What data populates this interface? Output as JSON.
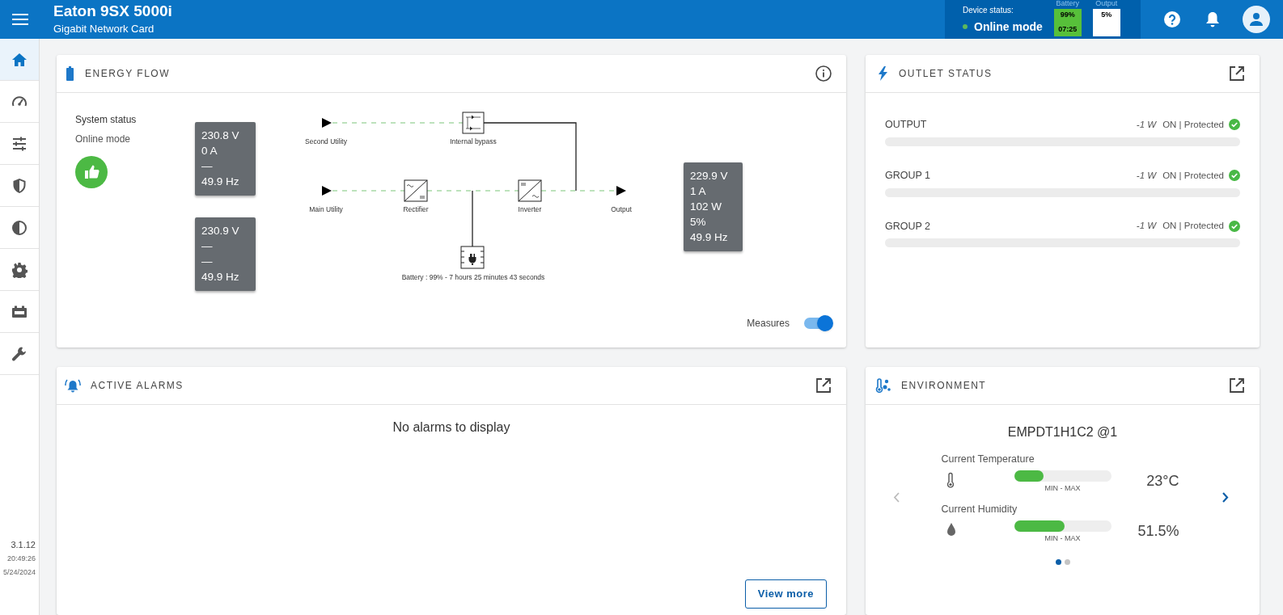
{
  "header": {
    "title": "Eaton 9SX 5000i",
    "subtitle": "Gigabit Network Card",
    "device_status_label": "Device status:",
    "device_status": "Online mode",
    "battery_label": "Battery",
    "battery_percent": "99%",
    "battery_time": "07:25",
    "output_label": "Output",
    "output_percent": "5%"
  },
  "sidebar": {
    "items": [
      {
        "selected": true
      },
      {
        "selected": false
      },
      {
        "selected": false
      },
      {
        "selected": false
      },
      {
        "selected": false
      },
      {
        "selected": false
      },
      {
        "selected": false
      },
      {
        "selected": false
      }
    ],
    "version": "3.1.12",
    "time": "20:49:26",
    "date": "5/24/2024"
  },
  "energy_flow": {
    "title": "ENERGY FLOW",
    "system_status_label": "System status",
    "system_status": "Online mode",
    "input_measures": [
      [
        "230.8 V",
        "0 A",
        "—",
        "49.9 Hz"
      ],
      [
        "230.9 V",
        "—",
        "—",
        "49.9 Hz"
      ]
    ],
    "nodes": [
      {
        "label": "Second Utility"
      },
      {
        "label": "Internal bypass"
      },
      {
        "label": "Main Utility"
      },
      {
        "label": "Rectifier"
      },
      {
        "label": "Inverter"
      },
      {
        "label": "Output"
      },
      {
        "label": "Battery : 99% - 7 hours 25 minutes 43 seconds"
      }
    ],
    "output_measures": [
      "229.9 V",
      "1 A",
      "102 W",
      "5%",
      "49.9 Hz"
    ],
    "measures_toggle": {
      "label": "Measures",
      "on": true
    }
  },
  "outlet_status": {
    "title": "OUTLET STATUS",
    "rows": [
      {
        "name": "OUTPUT",
        "power": "-1 W",
        "status": "ON | Protected",
        "level": 0
      },
      {
        "name": "GROUP 1",
        "power": "-1 W",
        "status": "ON | Protected",
        "level": 0
      },
      {
        "name": "GROUP 2",
        "power": "-1 W",
        "status": "ON | Protected",
        "level": 0
      }
    ]
  },
  "active_alarms": {
    "title": "ACTIVE ALARMS",
    "message": "No alarms to display",
    "button": "View more"
  },
  "environment": {
    "title": "ENVIRONMENT",
    "sensor": "EMPDT1H1C2 @1",
    "measures": [
      {
        "kind": "temperature",
        "label": "Current Temperature",
        "value": "23°C",
        "level": 0.3,
        "range_label": "MIN - MAX"
      },
      {
        "kind": "humidity",
        "label": "Current Humidity",
        "value": "51.5%",
        "level": 0.52,
        "range_label": "MIN - MAX"
      }
    ],
    "pages": [
      {
        "selected": true
      },
      {
        "selected": false
      }
    ]
  }
}
